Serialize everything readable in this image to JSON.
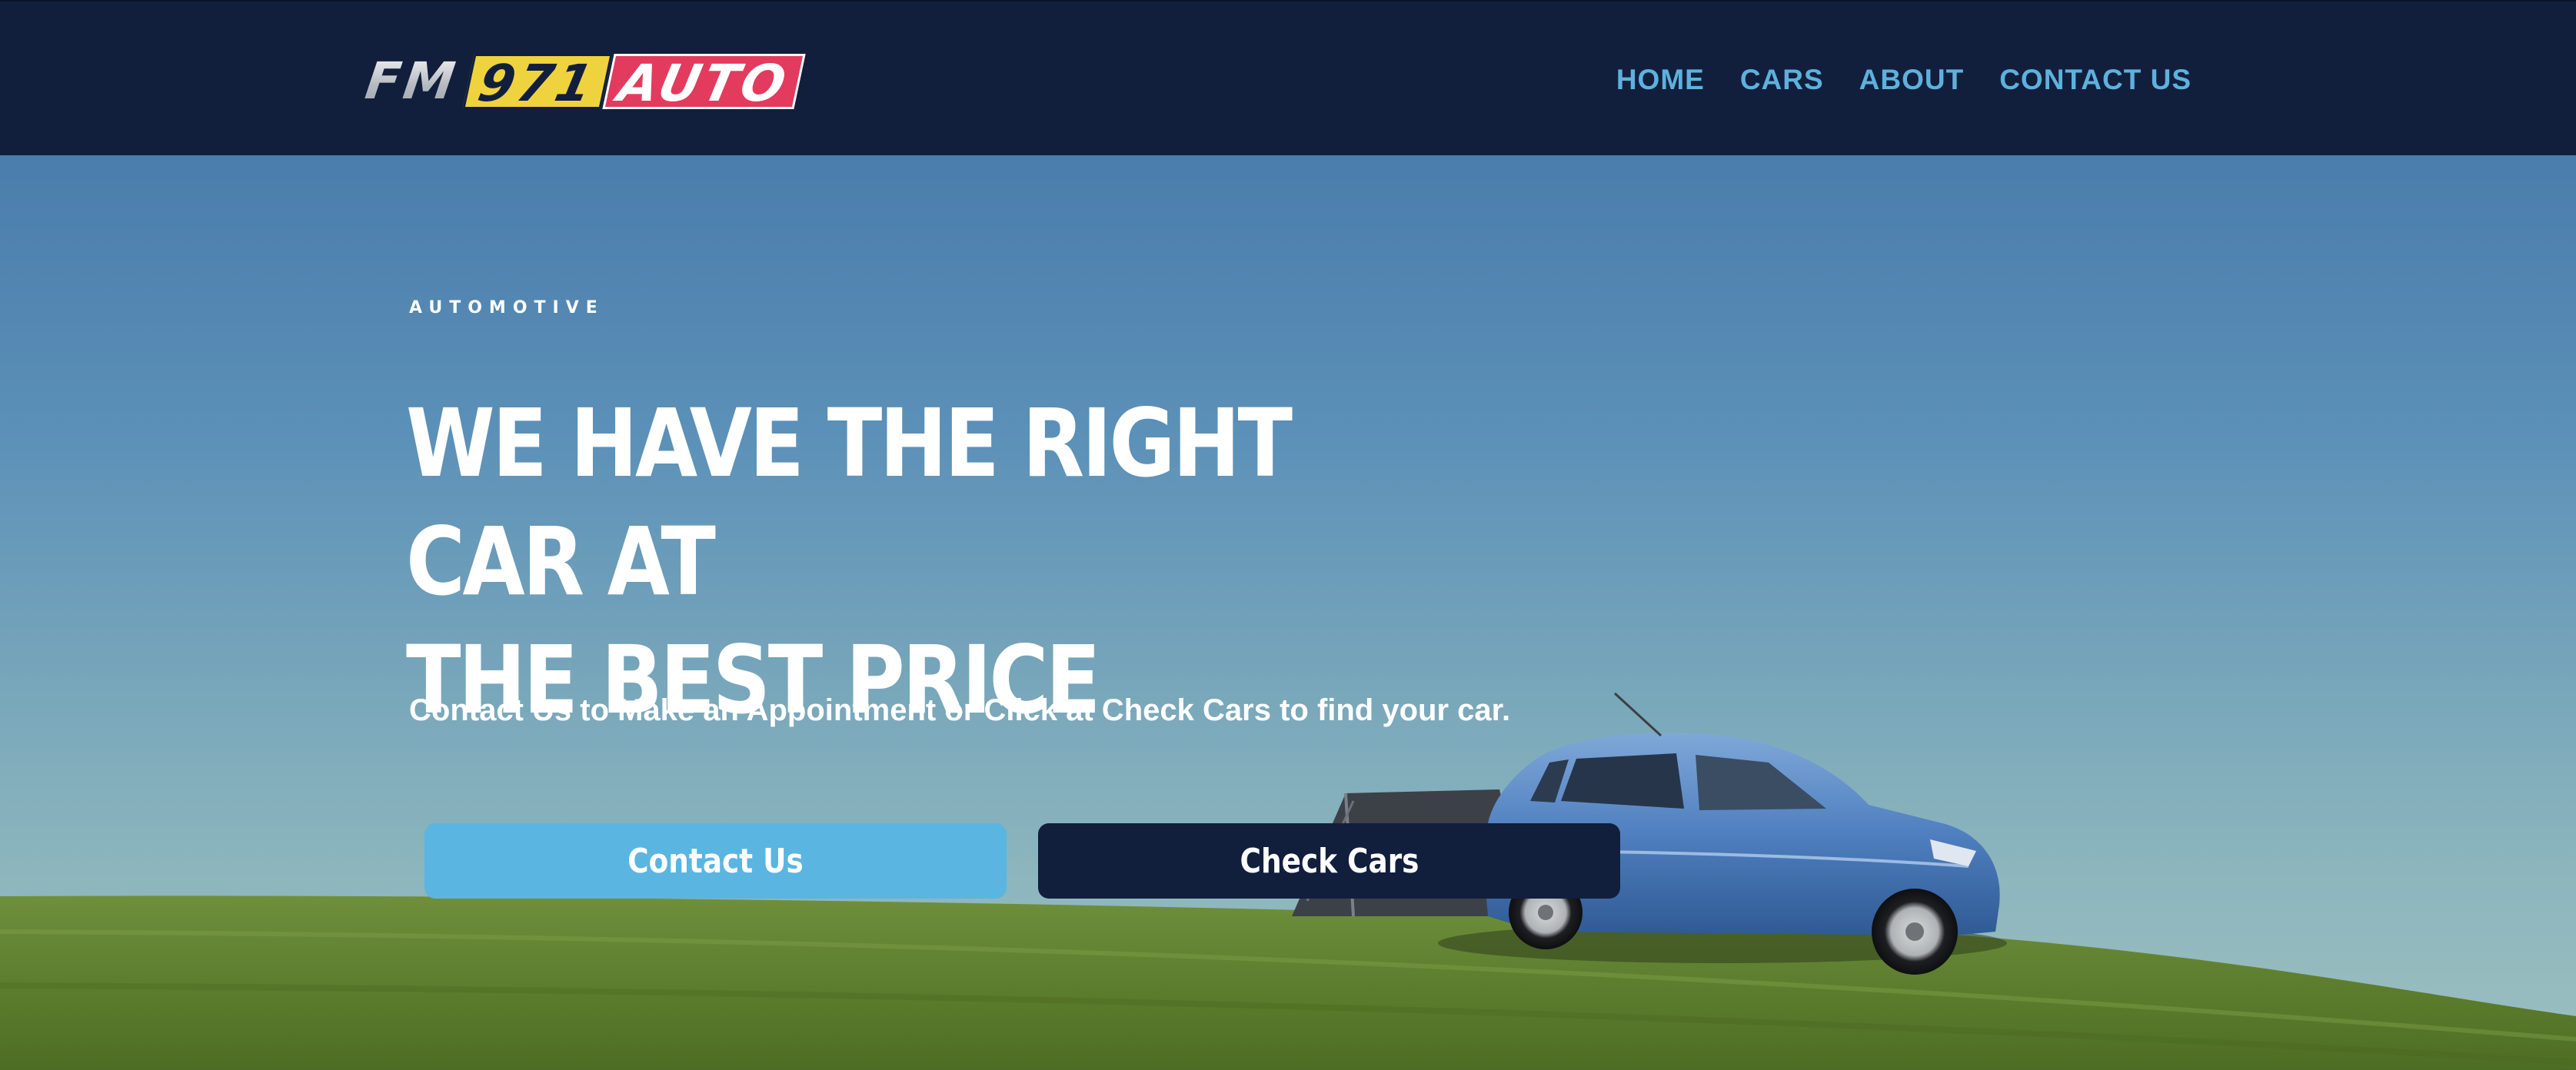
{
  "header": {
    "logo": {
      "part1": "FM",
      "part2": "971",
      "part3": "AUTO",
      "colors": {
        "number_bg": "#efd33e",
        "auto_bg": "#e23b5e"
      }
    },
    "nav": [
      {
        "label": "HOME"
      },
      {
        "label": "CARS"
      },
      {
        "label": "ABOUT"
      },
      {
        "label": "CONTACT US"
      }
    ],
    "colors": {
      "background": "#111f3d",
      "nav_link": "#5eb1dd"
    }
  },
  "hero": {
    "eyebrow": "AUTOMOTIVE",
    "headline_line1": "WE HAVE THE RIGHT CAR AT",
    "headline_line2": "THE BEST PRICE",
    "subtitle": "Contact Us to Make an Appointment or Click at Check Cars to find your car.",
    "buttons": {
      "contact_label": "Contact Us",
      "check_cars_label": "Check Cars"
    },
    "colors": {
      "contact_button": "#5bb5e1",
      "check_cars_button": "#111f3d"
    },
    "background_image": "blue-hatchback-car-on-grassy-hill"
  }
}
